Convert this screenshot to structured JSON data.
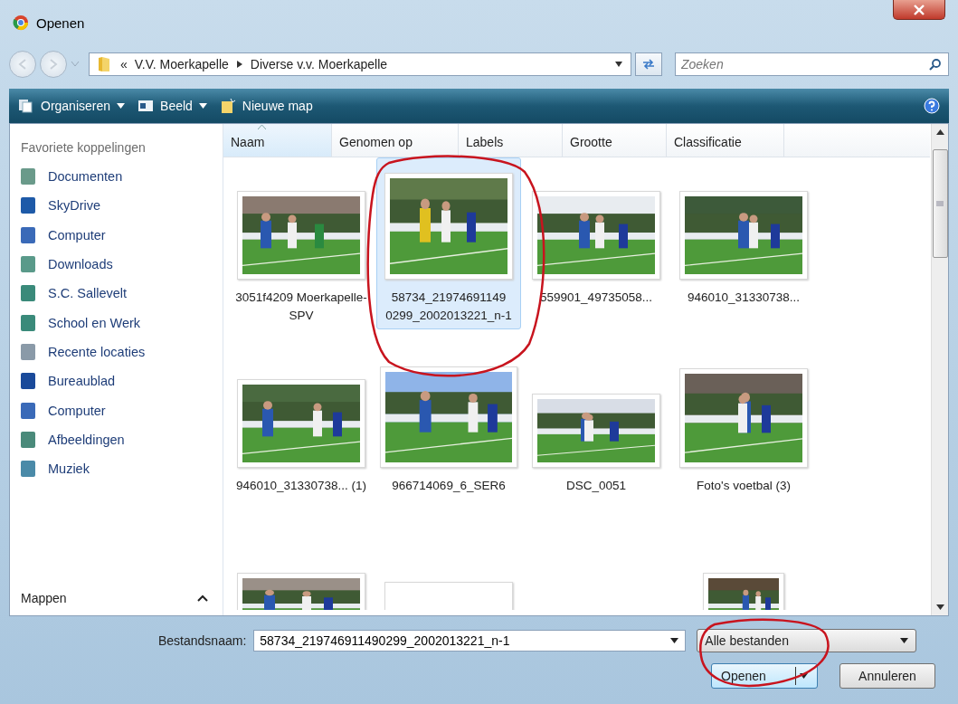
{
  "window": {
    "title": "Openen"
  },
  "address": {
    "crumbs": [
      "V.V. Moerkapelle",
      "Diverse v.v. Moerkapelle"
    ],
    "overflow": "«"
  },
  "search": {
    "placeholder": "Zoeken"
  },
  "toolbar": [
    {
      "label": "Organiseren",
      "kind": "menu"
    },
    {
      "label": "Beeld",
      "kind": "menu"
    },
    {
      "label": "Nieuwe map",
      "kind": "action"
    }
  ],
  "sidebar": {
    "heading": "Favoriete koppelingen",
    "items": [
      {
        "label": "Documenten",
        "kind": "documents"
      },
      {
        "label": "SkyDrive",
        "kind": "cloud"
      },
      {
        "label": "Computer",
        "kind": "computer"
      },
      {
        "label": "Downloads",
        "kind": "folder"
      },
      {
        "label": "S.C. Sallevelt",
        "kind": "library"
      },
      {
        "label": "School en Werk",
        "kind": "library"
      },
      {
        "label": "Recente locaties",
        "kind": "recent"
      },
      {
        "label": "Bureaublad",
        "kind": "desktop"
      },
      {
        "label": "Computer",
        "kind": "computer"
      },
      {
        "label": "Afbeeldingen",
        "kind": "pictures"
      },
      {
        "label": "Muziek",
        "kind": "music"
      }
    ],
    "footer": "Mappen",
    "footer_expanded": true
  },
  "columns": [
    {
      "label": "Naam",
      "sorted": true
    },
    {
      "label": "Genomen op",
      "sorted": false
    },
    {
      "label": "Labels",
      "sorted": false
    },
    {
      "label": "Grootte",
      "sorted": false
    },
    {
      "label": "Classificatie",
      "sorted": false
    }
  ],
  "files": [
    {
      "label": "3051f4209 Moerkapelle-SPV",
      "selected": false,
      "kind": "picture"
    },
    {
      "label": "58734_21974691149 0299_2002013221_n-1",
      "selected": true,
      "kind": "picture"
    },
    {
      "label": "559901_49735058...",
      "selected": false,
      "kind": "picture"
    },
    {
      "label": "946010_31330738...",
      "selected": false,
      "kind": "picture"
    },
    {
      "label": "946010_31330738... (1)",
      "selected": false,
      "kind": "picture"
    },
    {
      "label": "966714069_6_SER6",
      "selected": false,
      "kind": "picture"
    },
    {
      "label": "DSC_0051",
      "selected": false,
      "kind": "picture"
    },
    {
      "label": "Foto's voetbal (3)",
      "selected": false,
      "kind": "picture"
    },
    {
      "kind": "picture",
      "selected": false
    },
    {
      "kind": "generic",
      "selected": false
    },
    {
      "kind": "empty",
      "selected": false
    },
    {
      "kind": "picture",
      "selected": false
    }
  ],
  "filename": {
    "label": "Bestandsnaam:",
    "value": "58734_219746911490299_2002013221_n-1"
  },
  "filter": {
    "value": "Alle bestanden"
  },
  "buttons": [
    {
      "label": "Openen",
      "kind": "split"
    },
    {
      "label": "Annuleren",
      "kind": "plain"
    }
  ]
}
